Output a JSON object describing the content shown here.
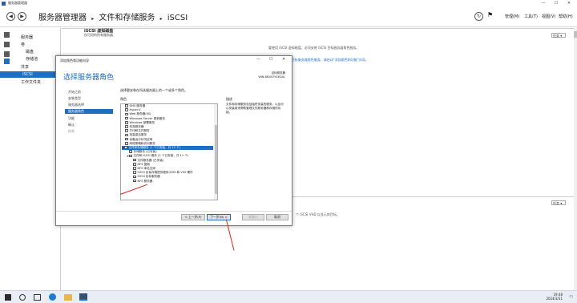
{
  "window": {
    "title": "服务器管理器",
    "controls": {
      "minimize": "—",
      "maximize": "☐",
      "close": "✕"
    }
  },
  "header": {
    "back": "◀",
    "forward": "▶",
    "breadcrumb": [
      "服务器管理器",
      "▸",
      "文件和存储服务",
      "▸",
      "iSCSI"
    ],
    "refresh": "↻",
    "flag": "⚑",
    "menus": [
      "管理(M)",
      "工具(T)",
      "视图(V)",
      "帮助(H)"
    ]
  },
  "sidebar": {
    "items": [
      {
        "label": "服务器",
        "indent": 1
      },
      {
        "label": "卷",
        "indent": 1
      },
      {
        "label": "磁盘",
        "indent": 2
      },
      {
        "label": "存储池",
        "indent": 2
      },
      {
        "label": "共享",
        "indent": 1
      },
      {
        "label": "iSCSI",
        "indent": 1,
        "selected": true
      },
      {
        "label": "工作文件夹",
        "indent": 1
      }
    ]
  },
  "main": {
    "group1": {
      "title": "iSCSI 虚拟磁盘",
      "subtitle": "仅可用的所有服务器",
      "tasks": "任务 ▾",
      "note1": "要使用 iSCSI 虚拟磁盘，必须安装 iSCSI 目标服务器角色服务。",
      "note2": "若要安装 iSCSI 目标服务器角色服务，请启动“添加角色和功能”向导。"
    },
    "group2": {
      "tasks": "任务 ▾",
      "note": "个 iSCSI VHD 以显示其目标。"
    }
  },
  "dialog": {
    "title": "添加角色和功能向导",
    "controls": {
      "minimize": "—",
      "maximize": "☐",
      "close": "✕"
    },
    "heading": "选择服务器角色",
    "target_label": "目标服务器",
    "target_value": "WIN-862N7916QAL",
    "steps": [
      {
        "label": "开始之前",
        "state": "normal"
      },
      {
        "label": "安装类型",
        "state": "normal"
      },
      {
        "label": "服务器选择",
        "state": "normal"
      },
      {
        "label": "服务器角色",
        "state": "selected"
      },
      {
        "label": "功能",
        "state": "normal"
      },
      {
        "label": "确认",
        "state": "normal"
      },
      {
        "label": "结果",
        "state": "disabled"
      }
    ],
    "instruction": "选择要安装在所选服务器上的一个或多个角色。",
    "roles_header": "角色",
    "desc_header": "描述",
    "description": "文件和存储服务包括始终安装的服务，以及可以安装用来帮助管理文件服务器和存储的功能。",
    "roles": [
      {
        "label": "DNS 服务器",
        "checked": false,
        "level": 0,
        "expander": ""
      },
      {
        "label": "Hyper-V",
        "checked": false,
        "level": 0,
        "expander": ""
      },
      {
        "label": "Web 服务器(IIS)",
        "checked": false,
        "level": 0,
        "expander": ""
      },
      {
        "label": "Windows Server 更新服务",
        "checked": false,
        "level": 0,
        "expander": ""
      },
      {
        "label": "Windows 部署服务",
        "checked": false,
        "level": 0,
        "expander": ""
      },
      {
        "label": "传真服务器",
        "checked": false,
        "level": 0,
        "expander": ""
      },
      {
        "label": "打印和文件服务",
        "checked": false,
        "level": 0,
        "expander": ""
      },
      {
        "label": "批量激活服务",
        "checked": false,
        "level": 0,
        "expander": ""
      },
      {
        "label": "设备运行状况证明",
        "checked": false,
        "level": 0,
        "expander": ""
      },
      {
        "label": "网络策略和访问服务",
        "checked": false,
        "level": 0,
        "expander": ""
      },
      {
        "label": "文件和存储服务 (1 个已安装，共 12 个)",
        "checked": "partial",
        "level": 0,
        "expander": "◢",
        "highlight": true
      },
      {
        "label": "存储服务 (已安装)",
        "checked": true,
        "level": 1,
        "expander": ""
      },
      {
        "label": "文件和 iSCSI 服务 (2 个已安装，共 11 个)",
        "checked": "partial",
        "level": 1,
        "expander": "◢"
      },
      {
        "label": "文件服务器 (已安装)",
        "checked": true,
        "level": 2,
        "expander": ""
      },
      {
        "label": "DFS 复制",
        "checked": false,
        "level": 2,
        "expander": ""
      },
      {
        "label": "DFS 命名空间",
        "checked": false,
        "level": 2,
        "expander": ""
      },
      {
        "label": "iSCSI 目标存储提供程序(VDS 和 VSS 硬件",
        "checked": false,
        "level": 2,
        "expander": ""
      },
      {
        "label": "iSCSI 目标服务器",
        "checked": true,
        "level": 2,
        "expander": ""
      },
      {
        "label": "NFS 服务器",
        "checked": false,
        "level": 2,
        "expander": ""
      }
    ],
    "buttons": {
      "prev": "< 上一步(P)",
      "next": "下一步(N) >",
      "install": "安装(I)",
      "cancel": "取消"
    }
  },
  "taskbar": {
    "time": "19:48",
    "date": "2024/3/31",
    "notify": "▭"
  }
}
